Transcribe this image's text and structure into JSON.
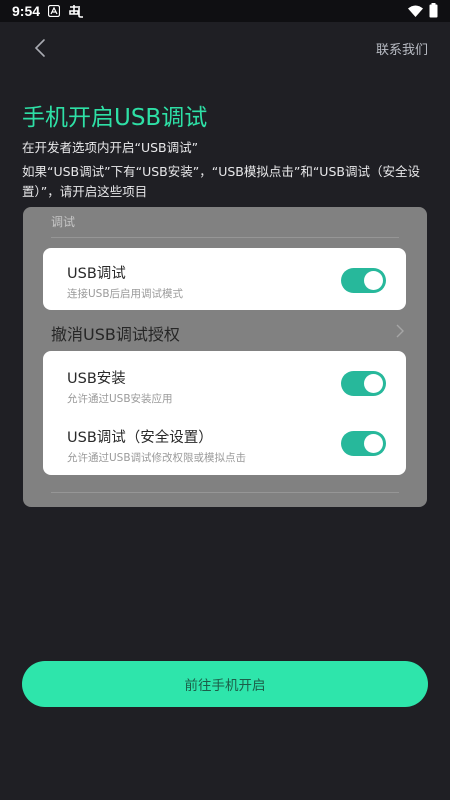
{
  "status_bar": {
    "time": "9:54",
    "icons": [
      "notification-a-icon",
      "app-icon",
      "wifi-icon",
      "battery-icon"
    ]
  },
  "header": {
    "back_icon": "chevron-left-icon",
    "contact_label": "联系我们"
  },
  "page": {
    "title": "手机开启USB调试",
    "instruction": "在开发者选项内开启“USB调试”",
    "instruction_detail": "如果“USB调试”下有“USB安装”，“USB模拟点击”和“USB调试（安全设置）”，请开启这些项目"
  },
  "example_screenshot": {
    "section_label": "调试",
    "usb_debug": {
      "title": "USB调试",
      "subtitle": "连接USB后启用调试模式",
      "enabled": true
    },
    "revoke_label": "撤消USB调试授权",
    "usb_install": {
      "title": "USB安装",
      "subtitle": "允许通过USB安装应用",
      "enabled": true
    },
    "usb_debug_secure": {
      "title": "USB调试（安全设置）",
      "subtitle": "允许通过USB调试修改权限或模拟点击",
      "enabled": true
    }
  },
  "cta": {
    "label": "前往手机开启"
  },
  "colors": {
    "accent": "#2ee0a6",
    "button": "#2ee5ab",
    "toggle_on": "#27b89b",
    "background": "#1f1f24"
  }
}
